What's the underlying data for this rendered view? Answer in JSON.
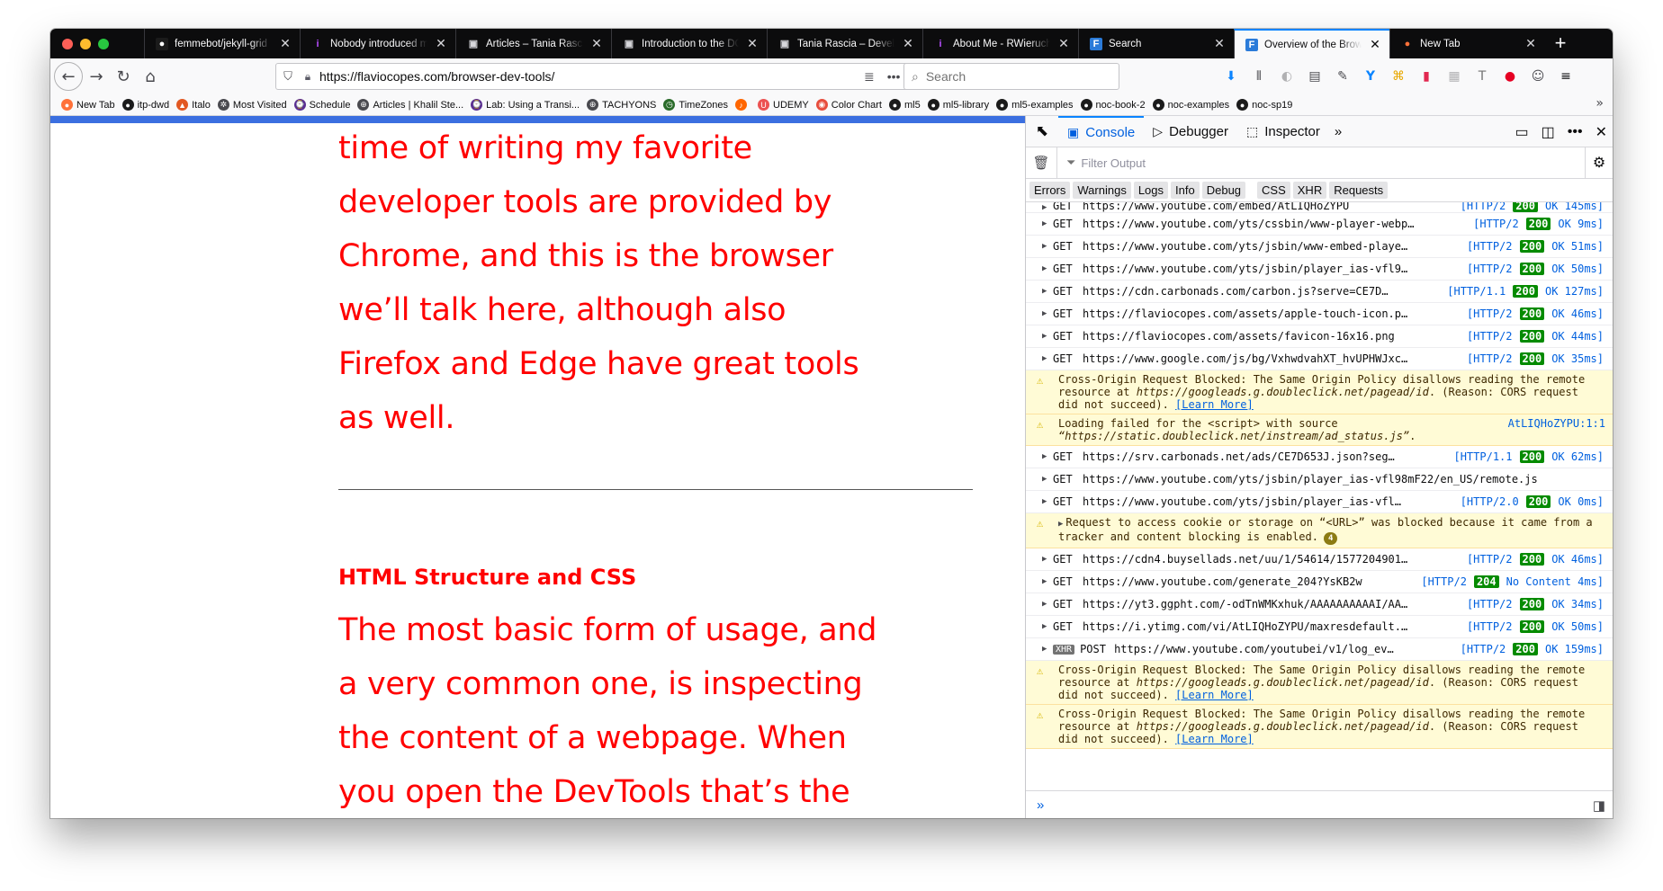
{
  "browser": {
    "tabs": [
      {
        "title": "femmebot/jekyll-grid",
        "icon": "github-icon",
        "icon_glyph": "●",
        "icon_color": "#1b1b1b",
        "icon_fg": "#ffffff",
        "active": false
      },
      {
        "title": "Nobody introduced me",
        "icon": "info-icon",
        "icon_glyph": "i",
        "icon_color": "#0c0c0d",
        "icon_fg": "#b84dff",
        "active": false
      },
      {
        "title": "Articles – Tania Rascia",
        "icon": "page-icon",
        "icon_glyph": "▣",
        "icon_color": "#0c0c0d",
        "icon_fg": "#d7d7db",
        "active": false
      },
      {
        "title": "Introduction to the DOM",
        "icon": "page-icon",
        "icon_glyph": "▣",
        "icon_color": "#0c0c0d",
        "icon_fg": "#d7d7db",
        "active": false
      },
      {
        "title": "Tania Rascia – Developer",
        "icon": "page-icon",
        "icon_glyph": "▣",
        "icon_color": "#0c0c0d",
        "icon_fg": "#d7d7db",
        "active": false
      },
      {
        "title": "About Me - RWieruch",
        "icon": "info-icon",
        "icon_glyph": "i",
        "icon_color": "#0c0c0d",
        "icon_fg": "#b84dff",
        "active": false
      },
      {
        "title": "Search",
        "icon": "flavio-icon",
        "icon_glyph": "F",
        "icon_color": "#2b7bd9",
        "icon_fg": "#ffffff",
        "active": false
      },
      {
        "title": "Overview of the Browser",
        "icon": "flavio-icon",
        "icon_glyph": "F",
        "icon_color": "#2b7bd9",
        "icon_fg": "#ffffff",
        "active": true
      },
      {
        "title": "New Tab",
        "icon": "firefox-icon",
        "icon_glyph": "●",
        "icon_color": "#0c0c0d",
        "icon_fg": "#ff7139",
        "active": false
      }
    ],
    "tab_close": "✕",
    "new_tab": "+",
    "url": "https://flaviocopes.com/browser-dev-tools/",
    "search_placeholder": "Search",
    "url_actions": [
      "≣",
      "•••",
      "♡"
    ],
    "toolbar_icons": [
      "⬇",
      "⫴",
      "◐",
      "▤",
      "✎",
      "Y",
      "⌘",
      "▮",
      "▦",
      "T",
      "●",
      "☺",
      "≡"
    ]
  },
  "bookmarks": [
    {
      "label": "New Tab",
      "icon": "firefox-icon",
      "color": "#ff7139",
      "glyph": "●"
    },
    {
      "label": "itp-dwd",
      "icon": "github-icon",
      "color": "#1b1b1b",
      "glyph": "●"
    },
    {
      "label": "Italo",
      "icon": "photo-icon",
      "color": "#e25822",
      "glyph": "▲"
    },
    {
      "label": "Most Visited",
      "icon": "gear-icon",
      "color": "#4a4a4f",
      "glyph": "✲"
    },
    {
      "label": "Schedule",
      "icon": "schedule-icon",
      "color": "#5b2e91",
      "glyph": "⌚"
    },
    {
      "label": "Articles | Khalil Ste...",
      "icon": "globe-icon",
      "color": "#4a4a4f",
      "glyph": "⊕"
    },
    {
      "label": "Lab: Using a Transi...",
      "icon": "lab-icon",
      "color": "#5b2e91",
      "glyph": "⌚"
    },
    {
      "label": "TACHYONS",
      "icon": "globe-icon",
      "color": "#4a4a4f",
      "glyph": "⊕"
    },
    {
      "label": "TimeZones",
      "icon": "clock-icon",
      "color": "#2a6b2a",
      "glyph": "◷"
    },
    {
      "label": "",
      "icon": "music-icon",
      "color": "#ff6600",
      "glyph": "♪"
    },
    {
      "label": "UDEMY",
      "icon": "udemy-icon",
      "color": "#ec5252",
      "glyph": "U"
    },
    {
      "label": "Color Chart",
      "icon": "color-chart-icon",
      "color": "#e74c3c",
      "glyph": "◉"
    },
    {
      "label": "ml5",
      "icon": "github-icon",
      "color": "#1b1b1b",
      "glyph": "●"
    },
    {
      "label": "ml5-library",
      "icon": "github-icon",
      "color": "#1b1b1b",
      "glyph": "●"
    },
    {
      "label": "ml5-examples",
      "icon": "github-icon",
      "color": "#1b1b1b",
      "glyph": "●"
    },
    {
      "label": "noc-book-2",
      "icon": "github-icon",
      "color": "#1b1b1b",
      "glyph": "●"
    },
    {
      "label": "noc-examples",
      "icon": "github-icon",
      "color": "#1b1b1b",
      "glyph": "●"
    },
    {
      "label": "noc-sp19",
      "icon": "github-icon",
      "color": "#1b1b1b",
      "glyph": "●"
    }
  ],
  "bookmarks_overflow": "»",
  "article": {
    "paragraph_1": "time of writing my favorite developer tools are provided by Chrome, and this is the browser we’ll talk here, although also Firefox and Edge have great tools as well.",
    "heading": "HTML Structure and CSS",
    "paragraph_2": "The most basic form of usage, and a very common one, is inspecting the content of a webpage. When you open the DevTools that’s the panel the Elements panel is what you see:",
    "text_color": "#ff0000"
  },
  "devtools": {
    "tabs": [
      {
        "label": "Console",
        "icon": "console-icon",
        "glyph": "▣",
        "active": true
      },
      {
        "label": "Debugger",
        "icon": "debugger-icon",
        "glyph": "▷",
        "active": false
      },
      {
        "label": "Inspector",
        "icon": "inspector-icon",
        "glyph": "⬚",
        "active": false
      }
    ],
    "more_tabs": "»",
    "filter_placeholder": "Filter Output",
    "levels": [
      "Errors",
      "Warnings",
      "Logs",
      "Info",
      "Debug"
    ],
    "categories": [
      "CSS",
      "XHR",
      "Requests"
    ],
    "log": [
      {
        "kind": "partial",
        "method": "GET",
        "url": "https://www.youtube.com/embed/AtLIQHoZYPU",
        "proto": "[HTTP/2",
        "code": "200",
        "status": "OK 145ms]"
      },
      {
        "kind": "net",
        "method": "GET",
        "url": "https://www.youtube.com/yts/cssbin/www-player-webp…",
        "proto": "[HTTP/2",
        "code": "200",
        "status": "OK 9ms]"
      },
      {
        "kind": "net",
        "method": "GET",
        "url": "https://www.youtube.com/yts/jsbin/www-embed-playe…",
        "proto": "[HTTP/2",
        "code": "200",
        "status": "OK 51ms]"
      },
      {
        "kind": "net",
        "method": "GET",
        "url": "https://www.youtube.com/yts/jsbin/player_ias-vfl9…",
        "proto": "[HTTP/2",
        "code": "200",
        "status": "OK 50ms]"
      },
      {
        "kind": "net",
        "method": "GET",
        "url": "https://cdn.carbonads.com/carbon.js?serve=CE7D…",
        "proto": "[HTTP/1.1",
        "code": "200",
        "status": "OK 127ms]"
      },
      {
        "kind": "net",
        "method": "GET",
        "url": "https://flaviocopes.com/assets/apple-touch-icon.p…",
        "proto": "[HTTP/2",
        "code": "200",
        "status": "OK 46ms]"
      },
      {
        "kind": "net",
        "method": "GET",
        "url": "https://flaviocopes.com/assets/favicon-16x16.png",
        "proto": "[HTTP/2",
        "code": "200",
        "status": "OK 44ms]"
      },
      {
        "kind": "net",
        "method": "GET",
        "url": "https://www.google.com/js/bg/VxhwdvahXT_hvUPHWJxc…",
        "proto": "[HTTP/2",
        "code": "200",
        "status": "OK 35ms]"
      },
      {
        "kind": "cors",
        "before": "Cross-Origin Request Blocked: The Same Origin Policy disallows reading the remote resource at ",
        "em": "https://googleads.g.doubleclick.net/pagead/id",
        "after": ". (Reason: CORS request did not succeed). ",
        "link": "[Learn More]"
      },
      {
        "kind": "load",
        "before": "Loading failed for the <script> with source ",
        "em": "“https://static.doubleclick.net/instream/ad_status.js”",
        "after": ".",
        "src": "AtLIQHoZYPU:1:1"
      },
      {
        "kind": "net",
        "method": "GET",
        "url": "https://srv.carbonads.net/ads/CE7D653J.json?seg…",
        "proto": "[HTTP/1.1",
        "code": "200",
        "status": "OK 62ms]"
      },
      {
        "kind": "net-plain",
        "method": "GET",
        "url": "https://www.youtube.com/yts/jsbin/player_ias-vfl98mF22/en_US/remote.js"
      },
      {
        "kind": "net",
        "method": "GET",
        "url": "https://www.youtube.com/yts/jsbin/player_ias-vfl…",
        "proto": "[HTTP/2.0",
        "code": "200",
        "status": "OK 0ms]"
      },
      {
        "kind": "cookie",
        "text": "Request to access cookie or storage on “<URL>” was blocked because it came from a tracker and content blocking is enabled.",
        "badge": "4"
      },
      {
        "kind": "net",
        "method": "GET",
        "url": "https://cdn4.buysellads.net/uu/1/54614/1577204901…",
        "proto": "[HTTP/2",
        "code": "200",
        "status": "OK 46ms]"
      },
      {
        "kind": "net",
        "method": "GET",
        "url": "https://www.youtube.com/generate_204?YsKB2w",
        "proto": "[HTTP/2",
        "code": "204",
        "status": "No Content 4ms]"
      },
      {
        "kind": "net",
        "method": "GET",
        "url": "https://yt3.ggpht.com/-odTnWMKxhuk/AAAAAAAAAAI/AA…",
        "proto": "[HTTP/2",
        "code": "200",
        "status": "OK 34ms]"
      },
      {
        "kind": "net",
        "method": "GET",
        "url": "https://i.ytimg.com/vi/AtLIQHoZYPU/maxresdefault.…",
        "proto": "[HTTP/2",
        "code": "200",
        "status": "OK 50ms]"
      },
      {
        "kind": "net",
        "xhr": "XHR",
        "method": "POST",
        "url": "https://www.youtube.com/youtubei/v1/log_ev…",
        "proto": "[HTTP/2",
        "code": "200",
        "status": "OK 159ms]"
      },
      {
        "kind": "cors",
        "before": "Cross-Origin Request Blocked: The Same Origin Policy disallows reading the remote resource at ",
        "em": "https://googleads.g.doubleclick.net/pagead/id",
        "after": ". (Reason: CORS request did not succeed). ",
        "link": "[Learn More]"
      },
      {
        "kind": "cors",
        "before": "Cross-Origin Request Blocked: The Same Origin Policy disallows reading the remote resource at ",
        "em": "https://googleads.g.doubleclick.net/pagead/id",
        "after": ". (Reason: CORS request did not succeed). ",
        "link": "[Learn More]"
      }
    ],
    "input_prompt": "»"
  }
}
